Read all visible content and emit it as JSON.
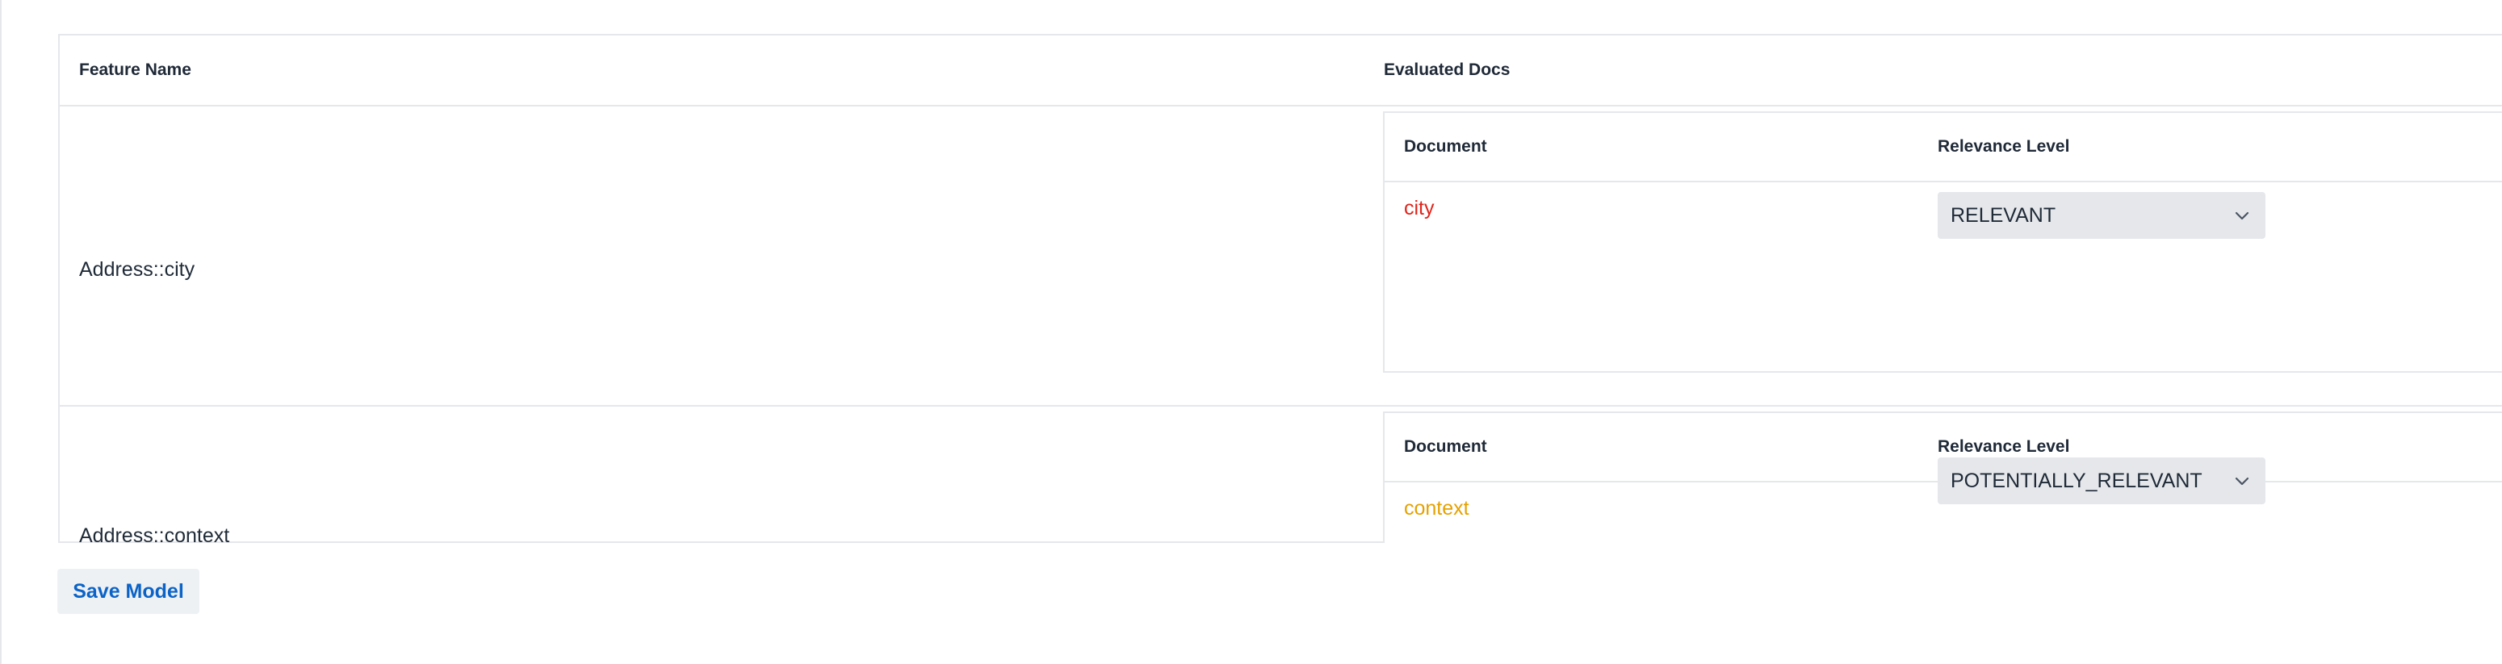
{
  "table": {
    "headers": {
      "feature_name": "Feature Name",
      "evaluated_docs": "Evaluated Docs"
    },
    "rows": [
      {
        "feature": "Address::city",
        "docs_header": {
          "document": "Document",
          "relevance": "Relevance Level"
        },
        "docs": [
          {
            "document": "city",
            "document_color": "#e0241b",
            "relevance": "RELEVANT"
          }
        ]
      },
      {
        "feature": "Address::context",
        "docs_header": {
          "document": "Document",
          "relevance": "Relevance Level"
        },
        "docs": [
          {
            "document": "context",
            "document_color": "#e6a100",
            "relevance": "POTENTIALLY_RELEVANT"
          }
        ]
      }
    ]
  },
  "icons": {
    "select_chevron": "chevron-down-icon"
  },
  "actions": {
    "save_label": "Save Model",
    "save_color": "#0b63c7"
  }
}
